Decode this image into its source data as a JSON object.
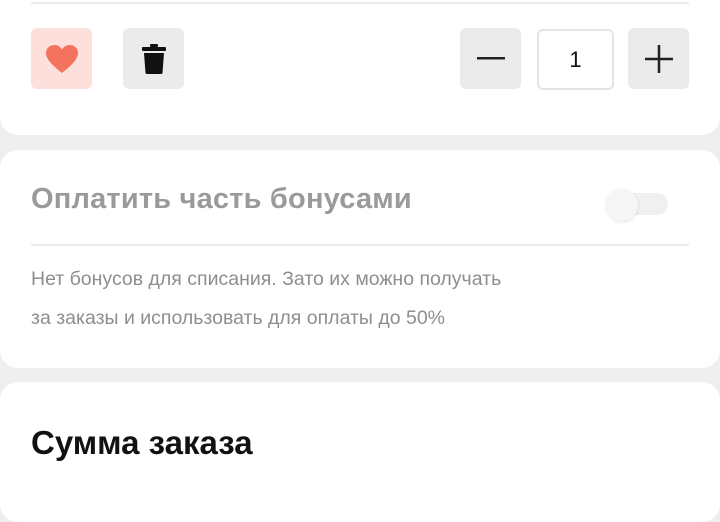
{
  "cart_item": {
    "quantity": "1"
  },
  "bonus": {
    "title": "Оплатить часть бонусами",
    "toggle_on": false,
    "note_line1": "Нет бонусов для списания. Зато их можно получать",
    "note_line2": "за заказы и использовать для оплаты до 50%"
  },
  "summary": {
    "title": "Сумма заказа"
  },
  "icons": {
    "favorite": "heart-icon",
    "delete": "trash-icon",
    "decrease": "minus-icon",
    "increase": "plus-icon"
  },
  "colors": {
    "favorite_accent": "#f4735e",
    "favorite_bg": "#fde0dc",
    "button_bg": "#ebebeb",
    "page_bg": "#efefef"
  }
}
